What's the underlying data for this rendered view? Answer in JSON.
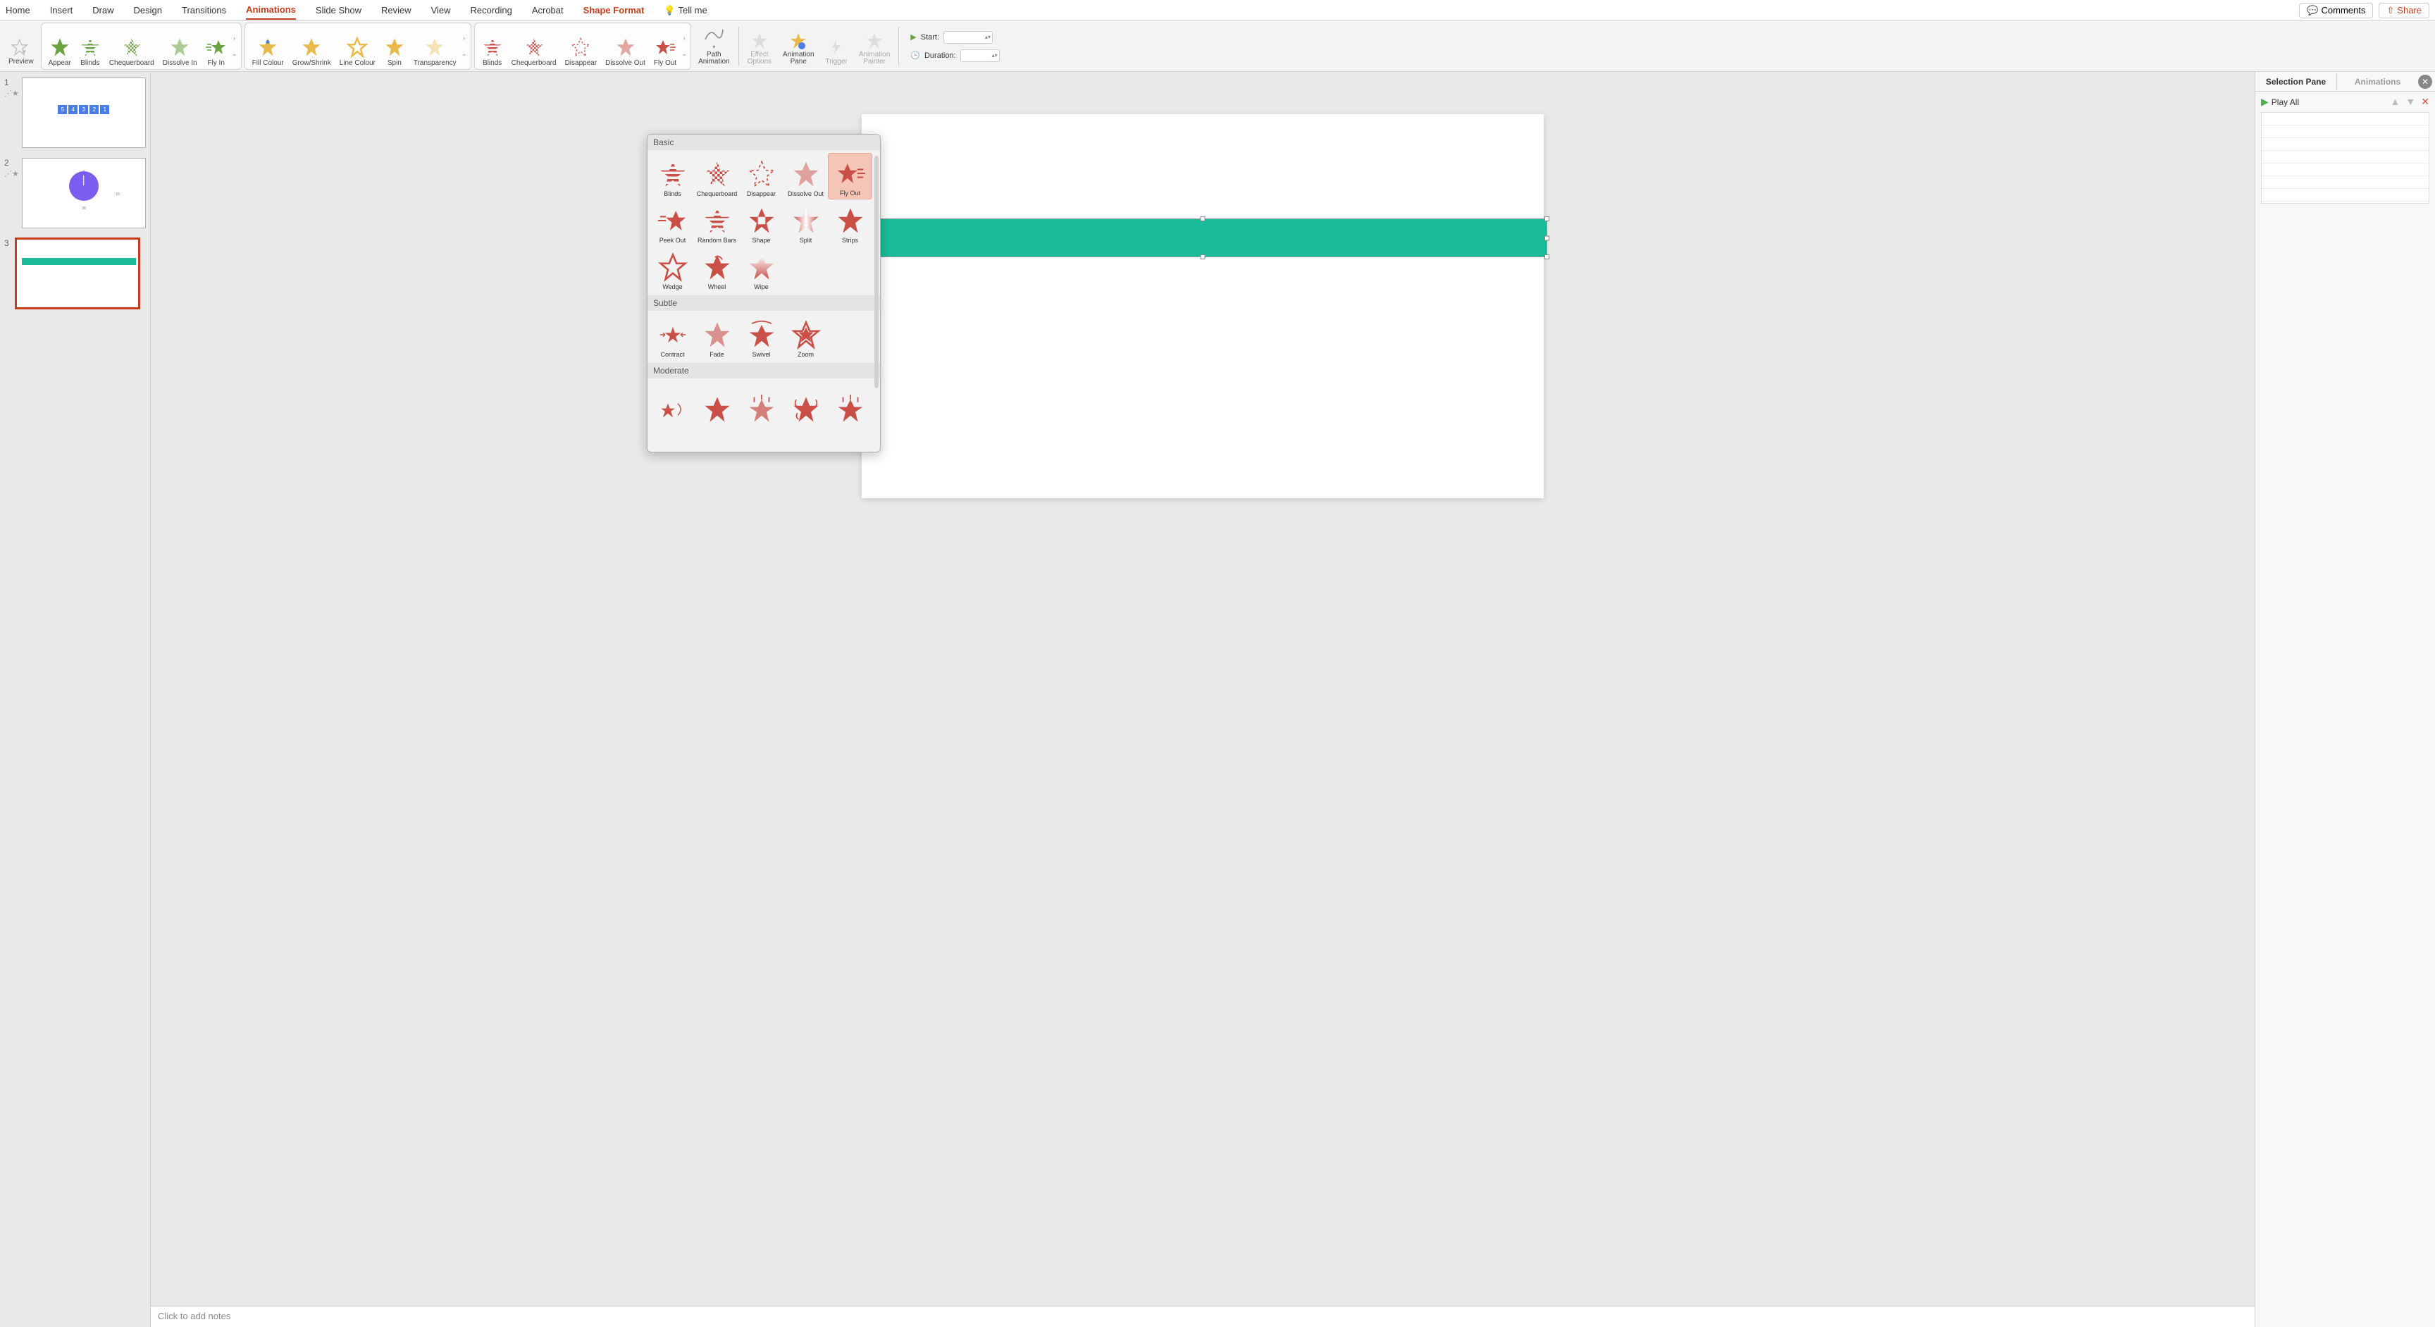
{
  "tabs": {
    "home": "Home",
    "insert": "Insert",
    "draw": "Draw",
    "design": "Design",
    "transitions": "Transitions",
    "animations": "Animations",
    "slideshow": "Slide Show",
    "review": "Review",
    "view": "View",
    "recording": "Recording",
    "acrobat": "Acrobat",
    "shape_format": "Shape Format",
    "tell_me": "Tell me"
  },
  "top_buttons": {
    "comments": "Comments",
    "share": "Share"
  },
  "ribbon": {
    "preview": "Preview",
    "entrance": {
      "appear": "Appear",
      "blinds": "Blinds",
      "chequerboard": "Chequerboard",
      "dissolve_in": "Dissolve In",
      "fly_in": "Fly In"
    },
    "emphasis": {
      "fill_colour": "Fill Colour",
      "grow_shrink": "Grow/Shrink",
      "line_colour": "Line Colour",
      "spin": "Spin",
      "transparency": "Transparency"
    },
    "exit": {
      "blinds": "Blinds",
      "chequerboard": "Chequerboard",
      "disappear": "Disappear",
      "dissolve_out": "Dissolve Out",
      "fly_out": "Fly Out"
    },
    "path_animation": "Path Animation",
    "effect_options": "Effect Options",
    "animation_pane": "Animation Pane",
    "trigger": "Trigger",
    "animation_painter": "Animation Painter",
    "timing": {
      "start_label": "Start:",
      "duration_label": "Duration:"
    }
  },
  "gallery": {
    "basic_header": "Basic",
    "basic": {
      "blinds": "Blinds",
      "chequerboard": "Chequerboard",
      "disappear": "Disappear",
      "dissolve_out": "Dissolve Out",
      "fly_out": "Fly Out",
      "peek_out": "Peek Out",
      "random_bars": "Random Bars",
      "shape": "Shape",
      "split": "Split",
      "strips": "Strips",
      "wedge": "Wedge",
      "wheel": "Wheel",
      "wipe": "Wipe"
    },
    "subtle_header": "Subtle",
    "subtle": {
      "contract": "Contract",
      "fade": "Fade",
      "swivel": "Swivel",
      "zoom": "Zoom"
    },
    "moderate_header": "Moderate"
  },
  "slides": {
    "n1": "1",
    "n2": "2",
    "n3": "3",
    "thumb1_nums": [
      "5",
      "4",
      "3",
      "2",
      "1"
    ]
  },
  "right_panel": {
    "selection_pane": "Selection Pane",
    "animations": "Animations",
    "play_all": "Play All"
  },
  "notes_placeholder": "Click to add notes",
  "colors": {
    "entrance": "#6aa241",
    "emphasis": "#e9b949",
    "exit": "#c94f47",
    "accent": "#c43e1c",
    "shape": "#1abc9c",
    "clock": "#7b5ef0"
  }
}
